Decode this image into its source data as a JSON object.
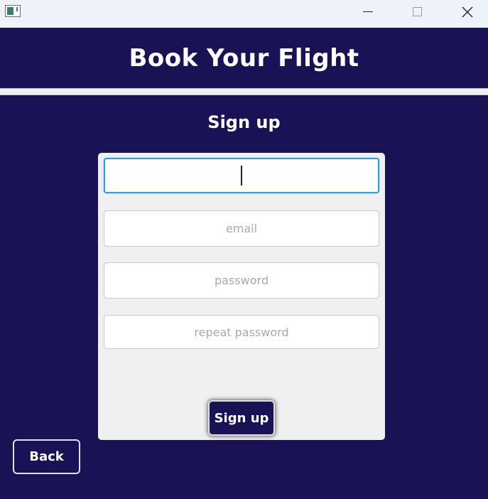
{
  "window": {
    "icons": {
      "app": "window-app-icon",
      "minimize": "minimize-icon",
      "maximize": "maximize-icon",
      "close": "close-icon"
    }
  },
  "header": {
    "title": "Book Your Flight"
  },
  "form": {
    "title": "Sign up",
    "fields": [
      {
        "name": "username",
        "value": "",
        "placeholder": ""
      },
      {
        "name": "email",
        "value": "",
        "placeholder": "email"
      },
      {
        "name": "password",
        "value": "",
        "placeholder": "password"
      },
      {
        "name": "repeat_password",
        "value": "",
        "placeholder": "repeat password"
      }
    ],
    "submit_label": "Sign up"
  },
  "nav": {
    "back_label": "Back"
  },
  "colors": {
    "background": "#191254",
    "card": "#f0f0f0",
    "focus_border": "#2aa0d6",
    "text_light": "#ffffff"
  }
}
